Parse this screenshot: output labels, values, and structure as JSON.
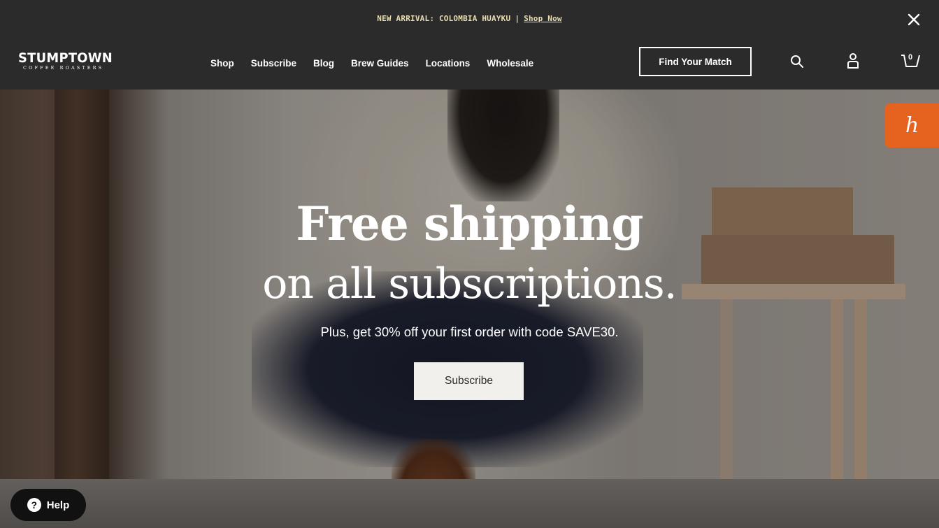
{
  "announcement": {
    "text": "NEW ARRIVAL: COLOMBIA HUAYKU",
    "separator": "|",
    "link_label": "Shop Now",
    "close_icon": "close-icon"
  },
  "header": {
    "logo": {
      "name": "STUMPTOWN",
      "tagline": "COFFEE ROASTERS"
    },
    "nav": [
      {
        "label": "Shop"
      },
      {
        "label": "Subscribe"
      },
      {
        "label": "Blog"
      },
      {
        "label": "Brew Guides"
      },
      {
        "label": "Locations"
      },
      {
        "label": "Wholesale"
      }
    ],
    "match_button": "Find Your Match",
    "icons": {
      "search": "search-icon",
      "account": "user-icon",
      "cart": "cart-icon"
    },
    "cart_count": "0"
  },
  "hero": {
    "headline_line1": "Free shipping",
    "headline_line2": "on all subscriptions.",
    "subtext": "Plus, get 30% off your first order with code SAVE30.",
    "cta_label": "Subscribe"
  },
  "widgets": {
    "honey_label": "h",
    "help_label": "Help",
    "help_icon_glyph": "?"
  },
  "colors": {
    "header_bg": "#2b2b2b",
    "announcement_text": "#e8dcb0",
    "honey_orange": "#e5631f",
    "cta_bg": "#f2f0ec"
  }
}
